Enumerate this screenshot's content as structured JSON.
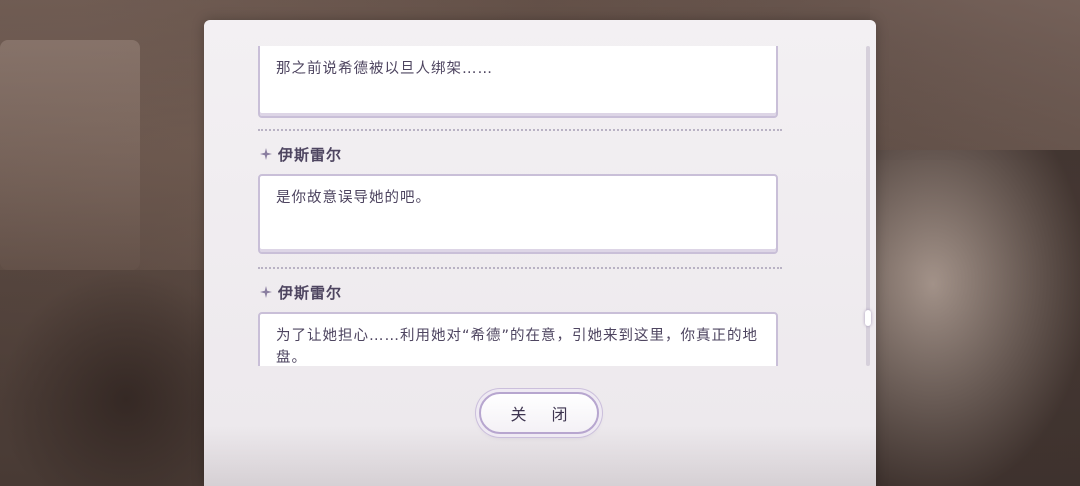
{
  "dialog_log": {
    "entries": [
      {
        "speaker": "",
        "text": "那之前说希德被以旦人绑架……"
      },
      {
        "speaker": "伊斯雷尔",
        "text": "是你故意误导她的吧。"
      },
      {
        "speaker": "伊斯雷尔",
        "text": "为了让她担心……利用她对“希德”的在意，引她来到这里，你真正的地盘。"
      }
    ],
    "close_label": "关 闭"
  },
  "colors": {
    "panel": "#f3f0f3",
    "text": "#4e4560",
    "textbox_border": "#c9bfd8",
    "accent": "#b7a6cf"
  },
  "icons": {
    "speaker_marker": "sparkle-star-icon"
  }
}
